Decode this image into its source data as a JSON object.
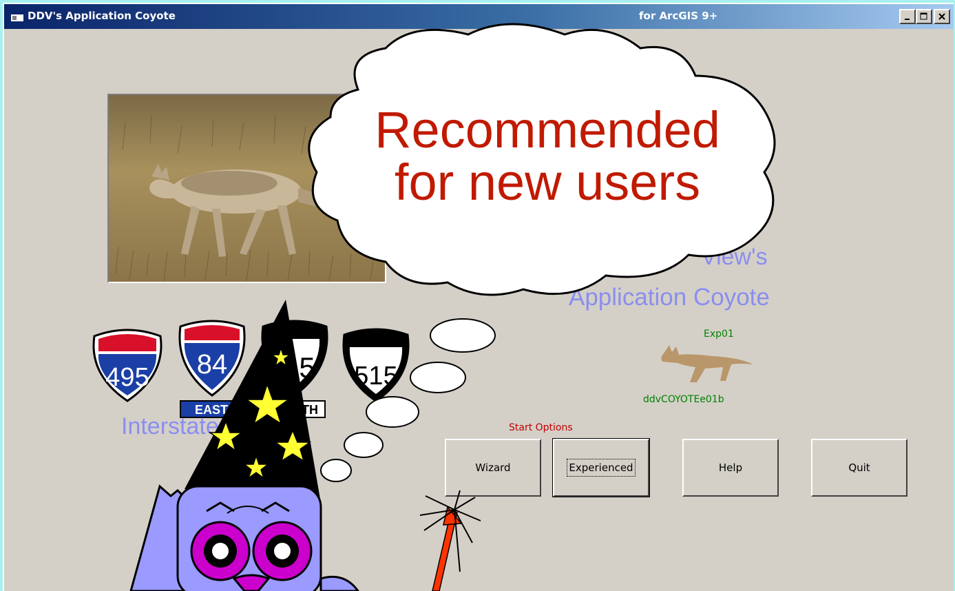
{
  "window": {
    "title": "DDV's Application Coyote",
    "subtitle": "for ArcGIS 9+",
    "controls": [
      "minimize-icon",
      "maximize-icon",
      "close-icon"
    ]
  },
  "main": {
    "view_label": "View's",
    "app_label": "Application Coyote",
    "interstate_label": "Interstate Routes",
    "shields": [
      {
        "number": "495",
        "kind": "interstate"
      },
      {
        "number": "84",
        "kind": "interstate",
        "direction": "EAST"
      },
      {
        "number": "5",
        "kind": "interstate",
        "direction": "TH"
      },
      {
        "number": "515",
        "kind": "state"
      }
    ],
    "coyote_icon": {
      "top_label": "Exp01",
      "bottom_label": "ddvCOYOTEe01b"
    },
    "start_options_label": "Start Options",
    "buttons": {
      "wizard": "Wizard",
      "experienced": "Experienced",
      "help": "Help",
      "quit": "Quit"
    }
  },
  "callout": {
    "line1": "Recommended",
    "line2": "for new users"
  },
  "colors": {
    "titlebar_start": "#0a246a",
    "window_bg": "#d4d0c8",
    "page_bg": "#a8f0f0",
    "label_blue": "#8a8ef0",
    "start_options_red": "#c00000",
    "callout_text": "#c01a00",
    "interstate_red": "#d8102a",
    "interstate_blue": "#1a3fa6",
    "owl_body": "#8888ff",
    "owl_eye": "#cc00cc"
  }
}
